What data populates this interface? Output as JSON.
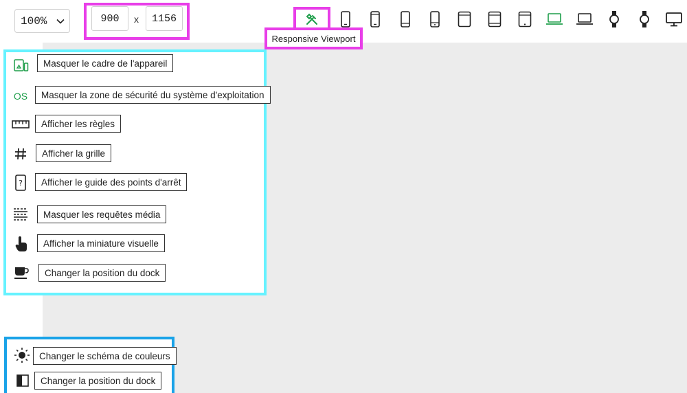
{
  "toolbar": {
    "zoom": "100%",
    "width": "900",
    "x_sep": "x",
    "height": "1156",
    "tooltip": "Responsive Viewport",
    "devices": [
      "responsive-icon",
      "phone-icon",
      "phone-icon",
      "phone-icon",
      "phone-icon",
      "tablet-icon",
      "tablet-icon",
      "tablet-icon",
      "laptop-icon",
      "laptop-icon",
      "watch-icon",
      "watch-icon",
      "desktop-icon"
    ]
  },
  "menu": {
    "items": [
      {
        "icon": "device-frame-icon",
        "label": "Masquer le cadre de l'appareil"
      },
      {
        "icon": "os-icon",
        "icon_text": "OS",
        "label": "Masquer la zone de sécurité du système d'exploitation"
      },
      {
        "icon": "ruler-icon",
        "label": "Afficher les règles"
      },
      {
        "icon": "grid-icon",
        "label": "Afficher la grille"
      },
      {
        "icon": "breakpoint-guide-icon",
        "label": "Afficher le guide des points d'arrêt"
      },
      {
        "icon": "media-queries-icon",
        "label": "Masquer les requêtes média"
      },
      {
        "icon": "hand-pointer-icon",
        "label": "Afficher la miniature visuelle"
      },
      {
        "icon": "cup-icon",
        "label": "Changer la position du dock"
      }
    ]
  },
  "bottom_menu": {
    "items": [
      {
        "icon": "sun-icon",
        "label": "Changer le schéma de couleurs"
      },
      {
        "icon": "dock-panel-icon",
        "label": "Changer la position du dock"
      }
    ]
  },
  "colors": {
    "accent": "#1e9e4a",
    "highlight": "#e83ee8",
    "panel_a": "#66f2ff",
    "panel_b": "#1aa3e8",
    "canvas": "#ececec"
  }
}
